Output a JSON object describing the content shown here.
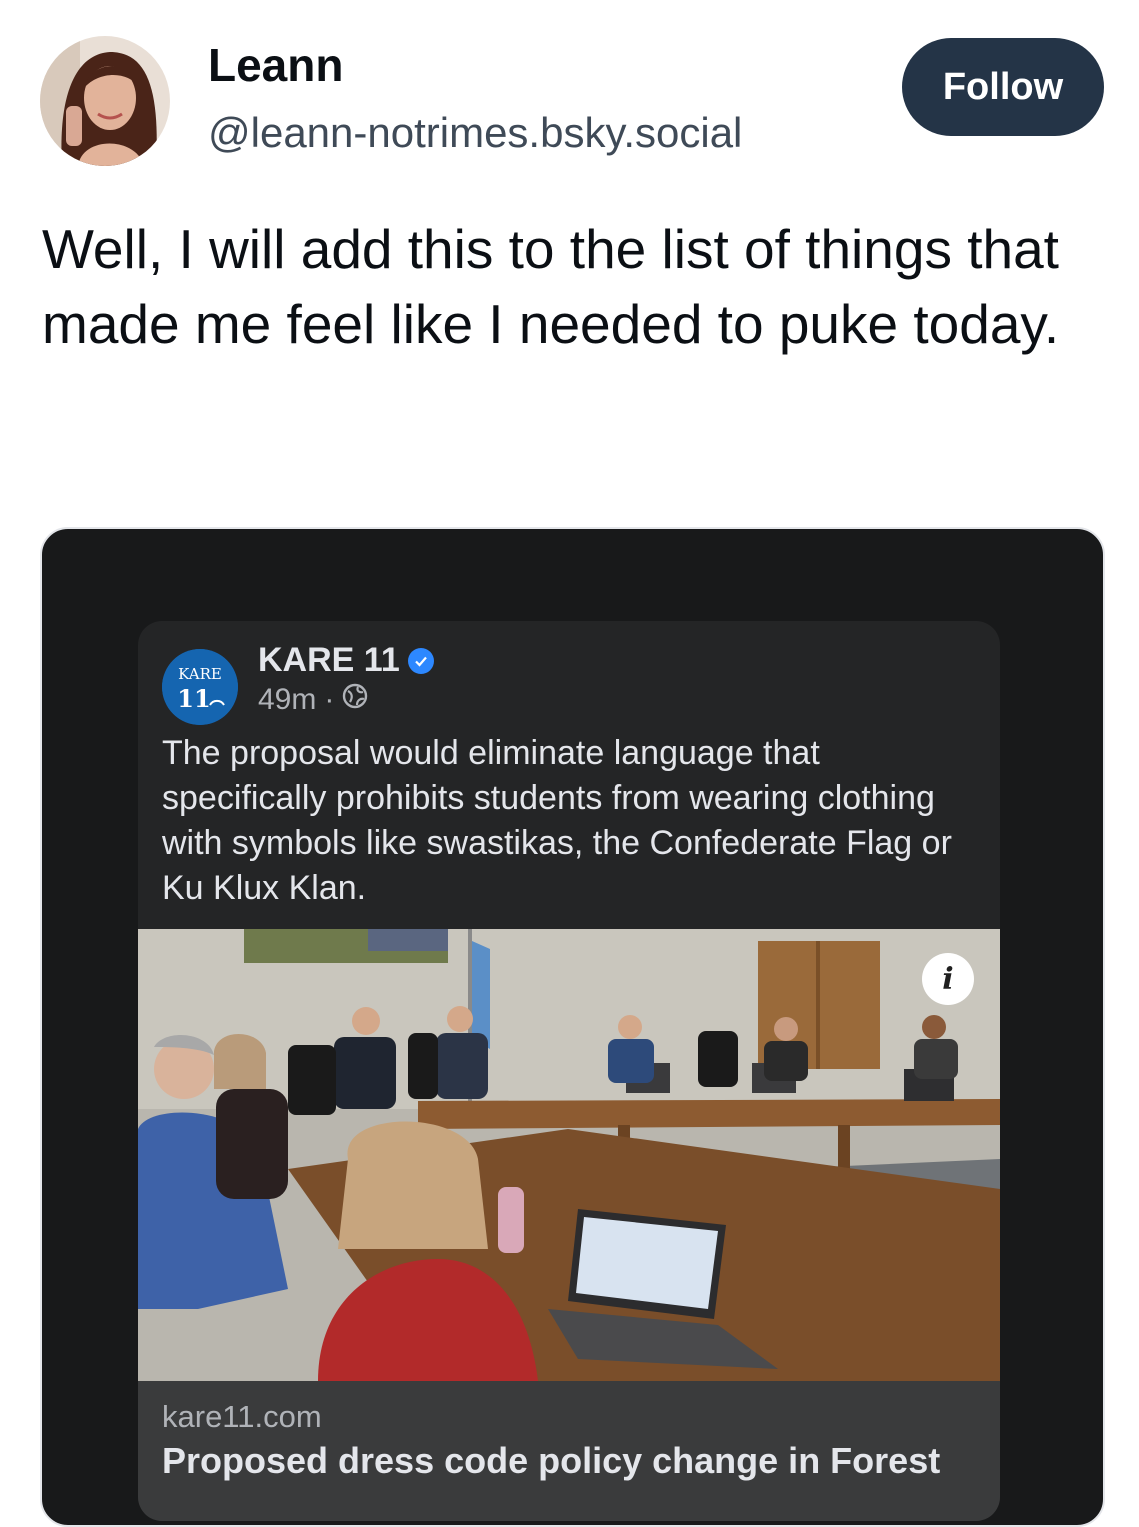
{
  "author": {
    "display_name": "Leann",
    "handle": "@leann-notrimes.bsky.social",
    "follow_label": "Follow"
  },
  "post": {
    "text": "Well, I will add this to the list of things that made me feel like I needed to puke today."
  },
  "embed": {
    "page_name": "KARE 11",
    "logo_text": "KARE",
    "logo_number": "11",
    "time": "49m",
    "separator": "·",
    "caption": "The proposal would eliminate language that specifically prohibits students from wearing clothing with symbols like swastikas, the Confederate Flag or Ku Klux Klan.",
    "info_label": "i",
    "domain": "kare11.com",
    "headline": "Proposed dress code policy change in Forest"
  },
  "colors": {
    "follow_bg": "#243447",
    "embed_bg": "#18191a",
    "card_bg": "#242526",
    "footer_bg": "#3a3b3c",
    "verified": "#2d88ff",
    "logo_bg": "#1565b0"
  },
  "icons": [
    "avatar-photo",
    "verified-badge-icon",
    "globe-icon",
    "info-icon"
  ]
}
